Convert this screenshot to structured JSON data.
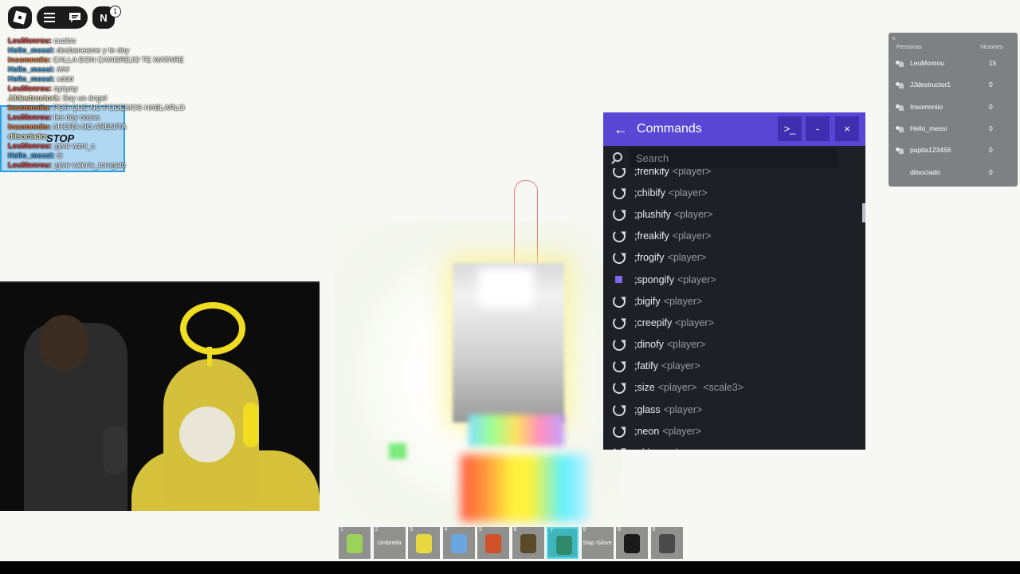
{
  "top_bar": {
    "notification_letter": "N",
    "notification_count": "1"
  },
  "chat": {
    "messages": [
      {
        "name": "LeuMonrou:",
        "text": "cuales",
        "color": "#d94a4a"
      },
      {
        "name": "Hello_messi:",
        "text": "desbaneame y te doy",
        "color": "#4aa6e6"
      },
      {
        "name": "Insomnniio:",
        "text": "CALLA DON CANGREJO TE MATARE",
        "color": "#e67a3a"
      },
      {
        "name": "Hello_messi:",
        "text": "###",
        "color": "#4aa6e6"
      },
      {
        "name": "Hello_messi:",
        "text": "xddd",
        "color": "#4aa6e6"
      },
      {
        "name": "LeuMonrou:",
        "text": "ayayay",
        "color": "#d94a4a"
      },
      {
        "name": "JJdestructor1:",
        "text": "Soy un ángel",
        "color": "#e6e0c0"
      },
      {
        "name": "Insomnniio:",
        "text": "POR QUE NO PODEMOS HABLARLO",
        "color": "#e67a3a"
      },
      {
        "name": "LeuMonrou:",
        "text": "les doy cosas",
        "color": "#d94a4a"
      },
      {
        "name": "Insomnniio:",
        "text": "AHORA NO ARENITA",
        "color": "#e67a3a"
      },
      {
        "name": "dilsociado:",
        "text": "",
        "color": "#e6e0c0"
      },
      {
        "name": "LeuMonrou:",
        "text": ";give wzni_c",
        "color": "#d94a4a"
      },
      {
        "name": "Hello_messi:",
        "text": "si",
        "color": "#4aa6e6"
      },
      {
        "name": "LeuMonrou:",
        "text": ";give valerie_turegalo",
        "color": "#d94a4a"
      }
    ],
    "overlay_text": "STOP"
  },
  "commands_panel": {
    "title": "Commands",
    "buttons": {
      "console": ">_",
      "minimize": "-",
      "close": "×"
    },
    "search_placeholder": "Search",
    "items": [
      {
        "name": ";frenkify",
        "args": "<player>",
        "extra": "",
        "icon": "refresh"
      },
      {
        "name": ";chibify",
        "args": "<player>",
        "extra": "",
        "icon": "refresh"
      },
      {
        "name": ";plushify",
        "args": "<player>",
        "extra": "",
        "icon": "refresh"
      },
      {
        "name": ";freakify",
        "args": "<player>",
        "extra": "",
        "icon": "refresh"
      },
      {
        "name": ";frogify",
        "args": "<player>",
        "extra": "",
        "icon": "refresh"
      },
      {
        "name": ";spongify",
        "args": "<player>",
        "extra": "",
        "icon": "square"
      },
      {
        "name": ";bigify",
        "args": "<player>",
        "extra": "",
        "icon": "refresh"
      },
      {
        "name": ";creepify",
        "args": "<player>",
        "extra": "",
        "icon": "refresh"
      },
      {
        "name": ";dinofy",
        "args": "<player>",
        "extra": "",
        "icon": "refresh"
      },
      {
        "name": ";fatify",
        "args": "<player>",
        "extra": "",
        "icon": "refresh"
      },
      {
        "name": ";size",
        "args": "<player>",
        "extra": "<scale3>",
        "icon": "refresh"
      },
      {
        "name": ";glass",
        "args": "<player>",
        "extra": "",
        "icon": "refresh"
      },
      {
        "name": ";neon",
        "args": "<player>",
        "extra": "",
        "icon": "refresh"
      },
      {
        "name": ";shine",
        "args": "<player>",
        "extra": "",
        "icon": "refresh"
      }
    ]
  },
  "leaderboard": {
    "close": "×",
    "col_people": "Personas",
    "col_wins": "Victories",
    "rows": [
      {
        "name": "LeuMonrou",
        "score": "15",
        "icon": true
      },
      {
        "name": "JJdestructor1",
        "score": "0",
        "icon": true
      },
      {
        "name": "Insomnniio",
        "score": "0",
        "icon": true
      },
      {
        "name": "Hello_messi",
        "score": "0",
        "icon": true
      },
      {
        "name": "papita123456",
        "score": "0",
        "icon": true
      },
      {
        "name": "dilsociado",
        "score": "0",
        "icon": false
      }
    ]
  },
  "hotbar": {
    "slots": [
      {
        "num": "1",
        "label": "",
        "art": "#9bd25a"
      },
      {
        "num": "2",
        "label": "Umbrella",
        "art": ""
      },
      {
        "num": "3",
        "label": "",
        "art": "#e8d840"
      },
      {
        "num": "4",
        "label": "",
        "art": "#6aa6e0"
      },
      {
        "num": "5",
        "label": "",
        "art": "#d0502a"
      },
      {
        "num": "6",
        "label": "",
        "art": "#5a4a2a"
      },
      {
        "num": "7",
        "label": "",
        "art": "#2f8a6a",
        "active": true
      },
      {
        "num": "8",
        "label": "Slap Glove",
        "art": ""
      },
      {
        "num": "9",
        "label": "",
        "art": "#1a1a1a"
      },
      {
        "num": "0",
        "label": "",
        "art": "#4a4a4a"
      }
    ]
  }
}
